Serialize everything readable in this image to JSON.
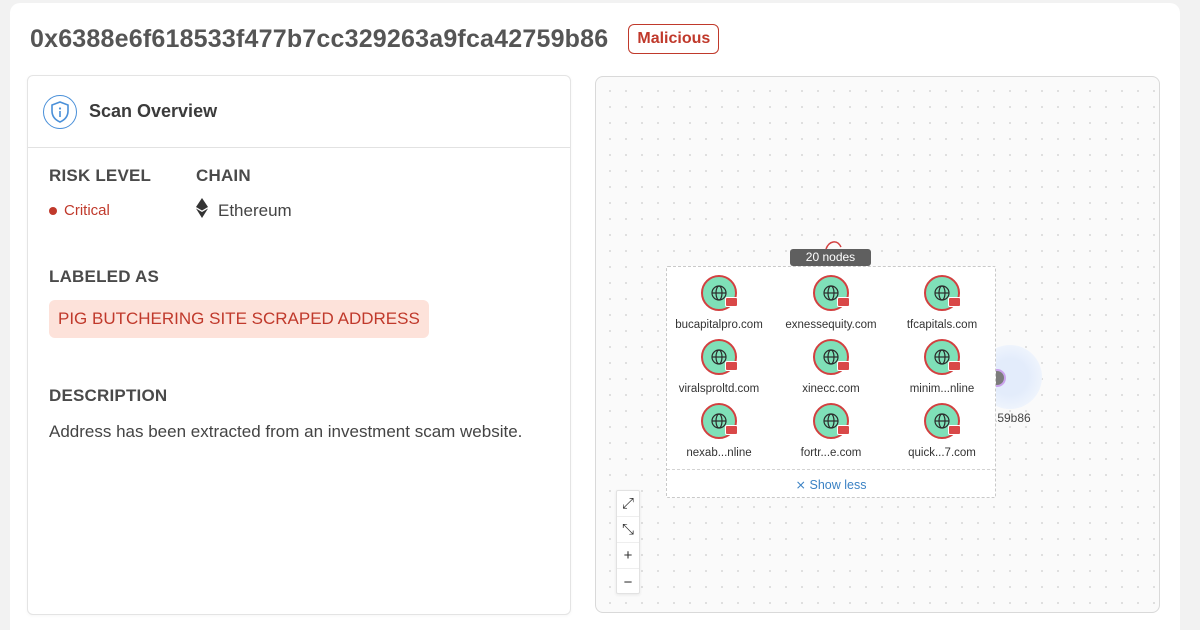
{
  "header": {
    "address": "0x6388e6f618533f477b7cc329263a9fca42759b86",
    "verdict_badge": "Malicious"
  },
  "overview": {
    "title": "Scan Overview",
    "risk_level_label": "RISK LEVEL",
    "risk_level_value": "Critical",
    "chain_label": "CHAIN",
    "chain_value": "Ethereum",
    "labeled_as_label": "LABELED AS",
    "labeled_as_tag": "PIG BUTCHERING SITE SCRAPED ADDRESS",
    "description_label": "DESCRIPTION",
    "description_text": "Address has been extracted from an investment scam website."
  },
  "graph": {
    "group_count": "20 nodes",
    "nodes": [
      {
        "label": "bucapitalpro.com"
      },
      {
        "label": "exnessequity.com"
      },
      {
        "label": "tfcapitals.com"
      },
      {
        "label": "viralsproltd.com"
      },
      {
        "label": "xinecc.com"
      },
      {
        "label": "minim...nline"
      },
      {
        "label": "nexab...nline"
      },
      {
        "label": "fortr...e.com"
      },
      {
        "label": "quick...7.com"
      }
    ],
    "show_less": "Show less",
    "side_node_label": ".59b86",
    "controls": {
      "fit": "⤢",
      "shrink": "⤡",
      "zoom_in": "+",
      "zoom_out": "−"
    },
    "colors": {
      "node_fill": "#7fe0b8",
      "node_border": "#d24040",
      "accent": "#3b82c4"
    }
  },
  "colors": {
    "danger": "#c0392b",
    "tag_bg": "#fde2da"
  }
}
